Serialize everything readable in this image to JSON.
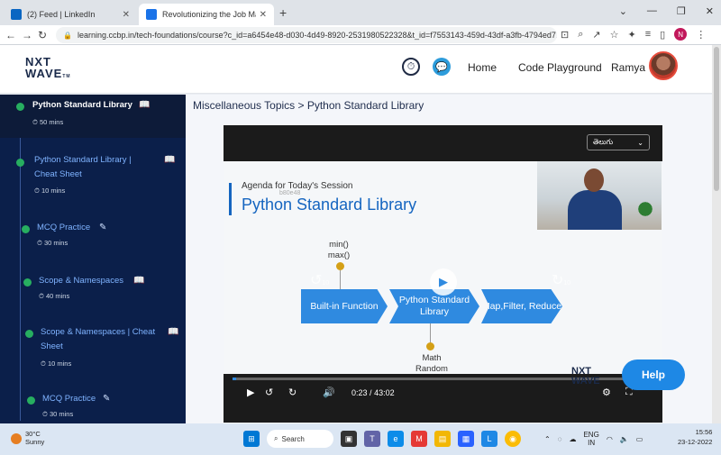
{
  "browser": {
    "tabs": [
      {
        "label": "(2) Feed | LinkedIn",
        "icon": "linkedin-icon"
      },
      {
        "label": "Revolutionizing the Job Market |",
        "icon": "ccbp-icon"
      }
    ],
    "url": "learning.ccbp.in/tech-foundations/course?c_id=a6454e48-d030-4d49-8920-2531980522328&t_id=f7553143-459d-43df-a3fb-4794ed7...",
    "profile_initial": "N"
  },
  "header": {
    "logo_line1": "NXT",
    "logo_line2": "WAVE",
    "logo_tm": "TM",
    "nav": [
      "Home",
      "Code Playground"
    ],
    "user_name": "Ramya"
  },
  "sidebar": {
    "items": [
      {
        "title": "Python Standard Library",
        "duration": "50 mins",
        "icon": "book-icon",
        "active": true
      },
      {
        "title": "Python Standard Library | Cheat Sheet",
        "duration": "10 mins",
        "icon": "book-icon"
      },
      {
        "title": "MCQ Practice",
        "duration": "30 mins",
        "icon": "pencil-icon"
      },
      {
        "title": "Scope & Namespaces",
        "duration": "40 mins",
        "icon": "book-icon"
      },
      {
        "title": "Scope & Namespaces | Cheat Sheet",
        "duration": "10 mins",
        "icon": "book-icon"
      },
      {
        "title": "MCQ Practice",
        "duration": "30 mins",
        "icon": "pencil-icon"
      }
    ]
  },
  "content": {
    "breadcrumb": "Miscellaneous Topics > Python Standard Library",
    "player": {
      "language": "తెలుగు",
      "slide": {
        "agenda": "Agenda for Today's Session",
        "code": "b80e48",
        "title": "Python Standard Library",
        "top_label_1": "min()",
        "top_label_2": "max()",
        "flow": [
          "Built-in Function",
          "Python Standard Library",
          "Map,Filter, Reduce"
        ],
        "bottom_label_1": "Math",
        "bottom_label_2": "Random"
      },
      "skip_back": "10",
      "skip_forward": "10",
      "progress": 0.009,
      "time_current": "0:23",
      "time_separator": "/",
      "time_total": "43:02",
      "watermark_line1": "NXT",
      "watermark_line2": "WAVE"
    }
  },
  "help_label": "Help",
  "taskbar": {
    "temperature": "30°C",
    "weather": "Sunny",
    "search_label": "Search",
    "lang_line1": "ENG",
    "lang_line2": "IN",
    "time": "15:56",
    "date": "23-12-2022"
  }
}
